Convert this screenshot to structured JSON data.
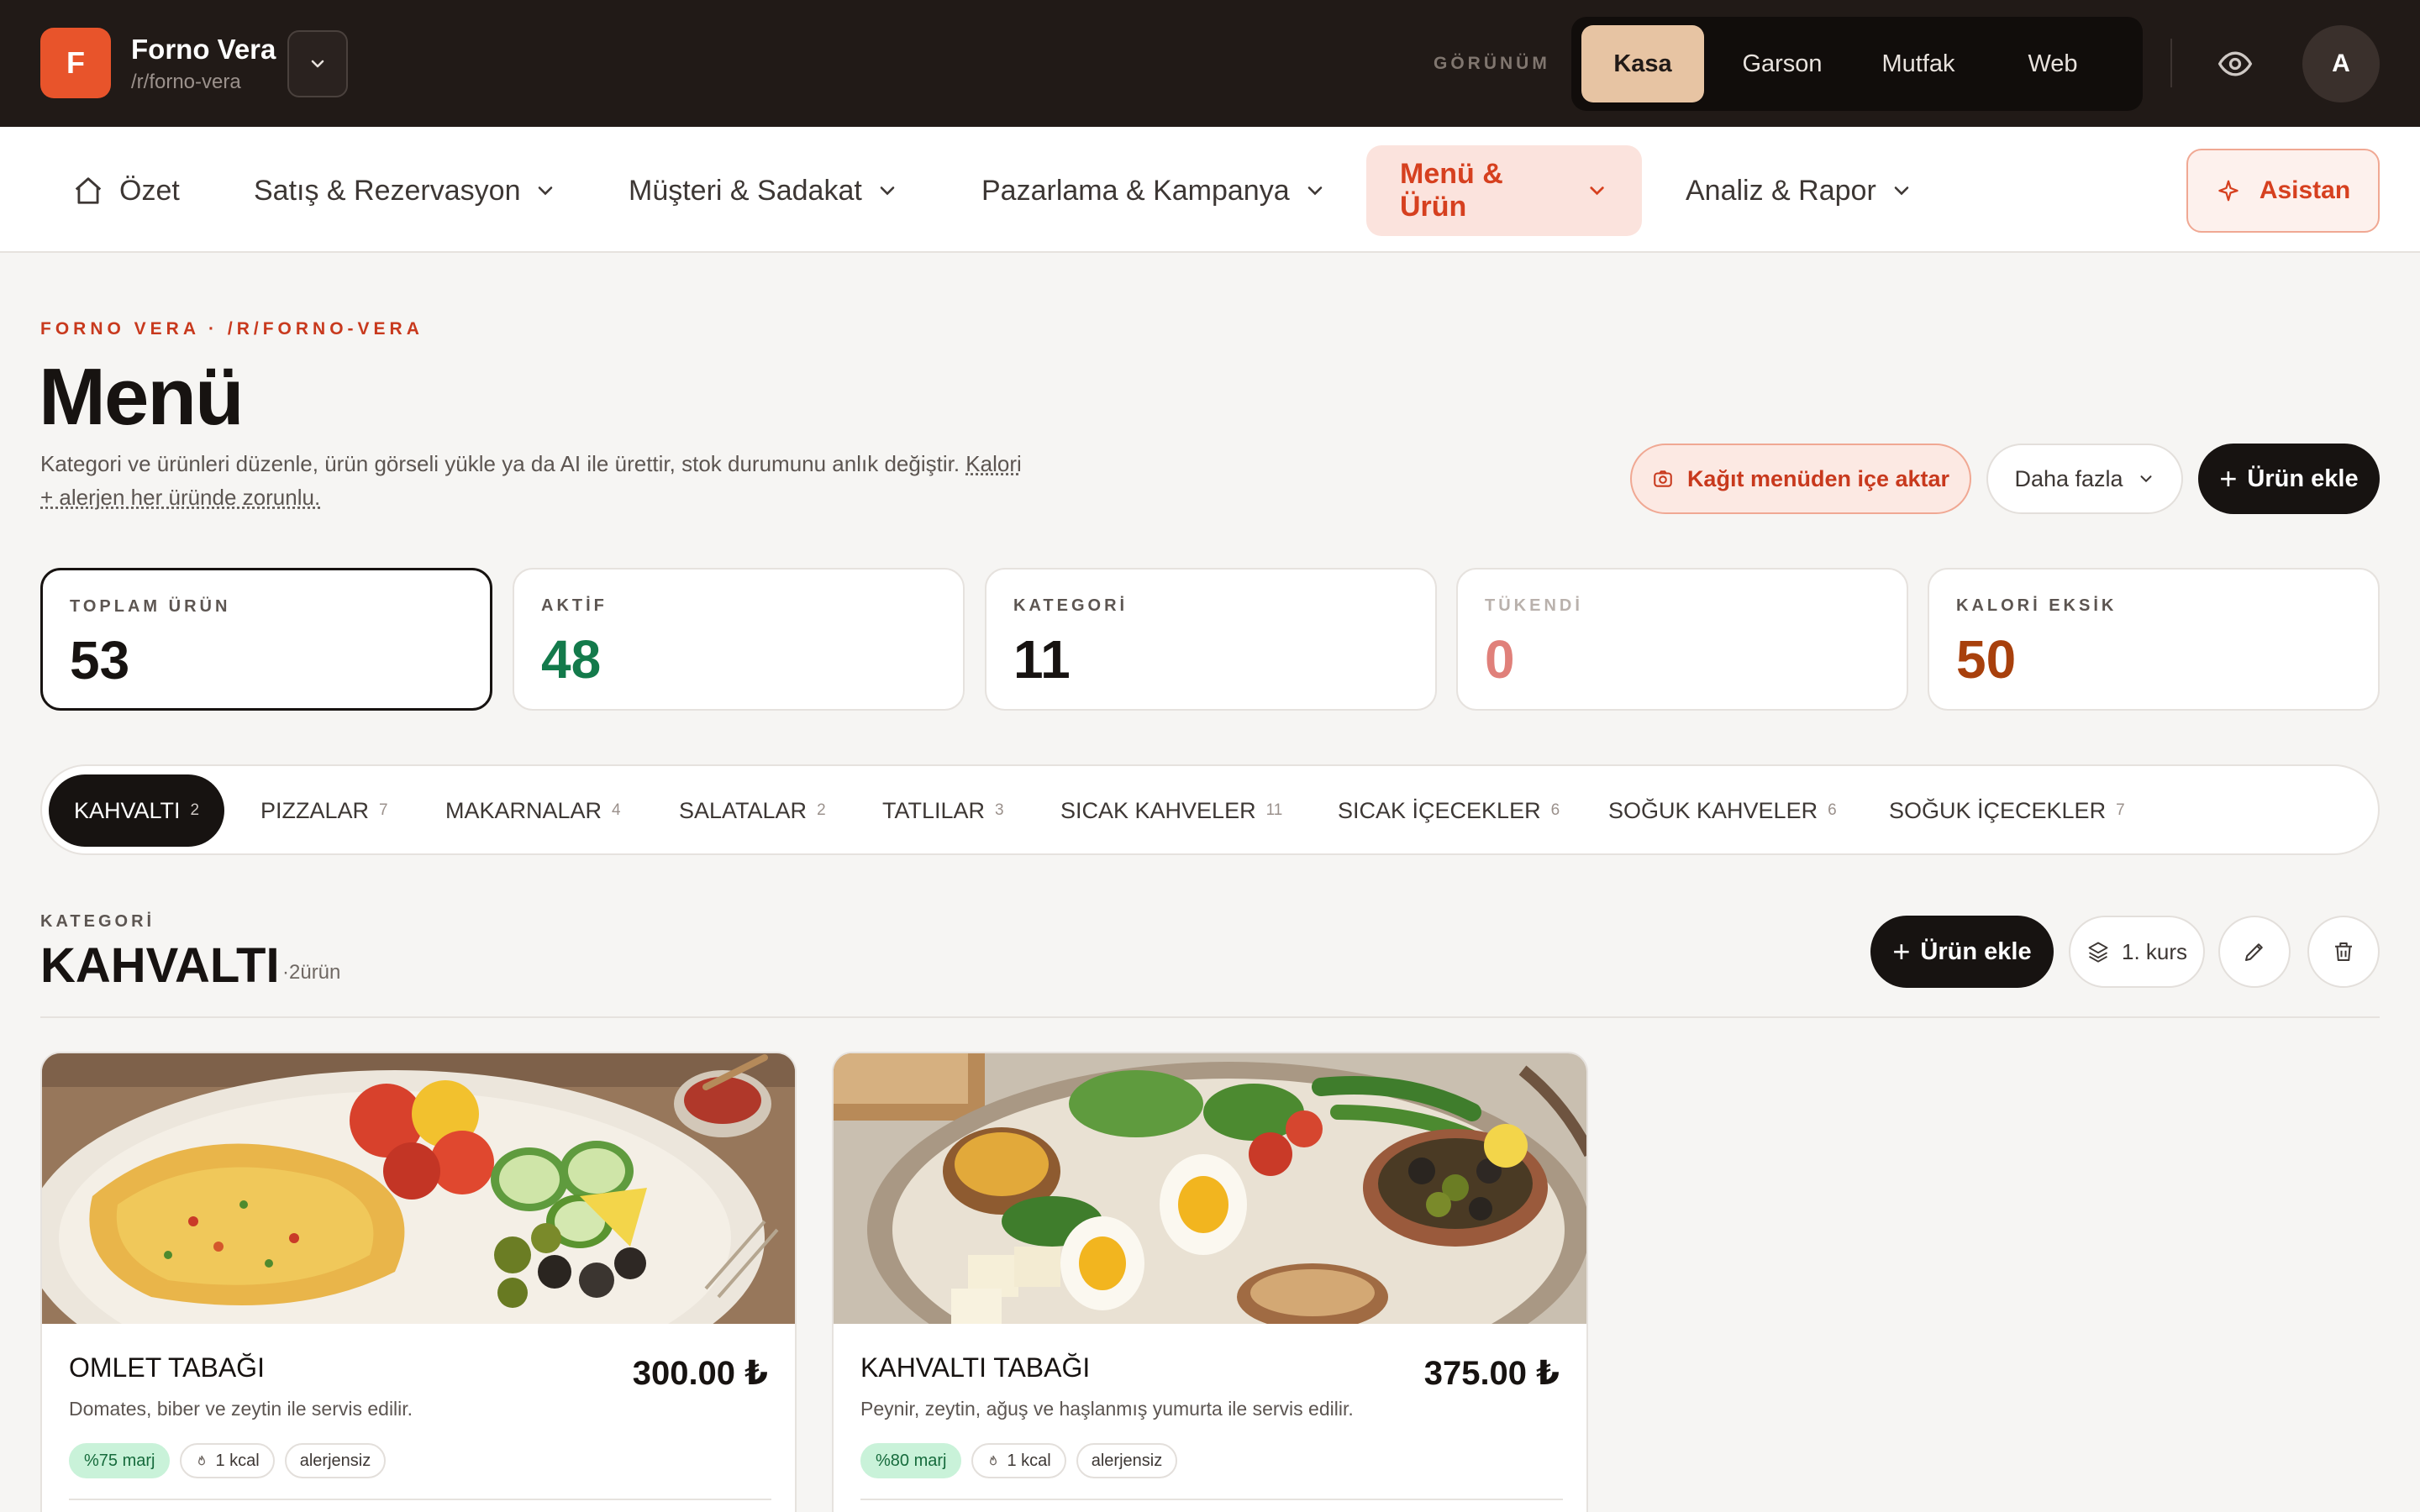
{
  "brand": {
    "initial": "F",
    "name": "Forno Vera",
    "slug": "/r/forno-vera"
  },
  "view_switch": {
    "label": "GÖRÜNÜM",
    "options": [
      "Kasa",
      "Garson",
      "Mutfak",
      "Web"
    ],
    "active": "Kasa"
  },
  "user": {
    "avatar_initial": "A"
  },
  "nav": {
    "items": [
      {
        "label": "Özet"
      },
      {
        "label": "Satış & Rezervasyon"
      },
      {
        "label": "Müşteri & Sadakat"
      },
      {
        "label": "Pazarlama & Kampanya"
      },
      {
        "label": "Menü & Ürün"
      },
      {
        "label": "Analiz & Rapor"
      }
    ],
    "active": "Menü & Ürün",
    "assistant_label": "Asistan"
  },
  "header": {
    "eyebrow": "FORNO VERA · /R/FORNO-VERA",
    "title": "Menü",
    "description_part1": "Kategori ve ürünleri düzenle, ürün görseli yükle ya da AI ile ürettir, stok durumunu anlık değiştir. ",
    "description_link": "Kalori + alerjen her üründe zorunlu.",
    "import_label": "Kağıt menüden içe aktar",
    "more_label": "Daha fazla",
    "add_label": "Ürün ekle"
  },
  "stats": [
    {
      "label": "TOPLAM ÜRÜN",
      "value": "53",
      "color": "#171311"
    },
    {
      "label": "AKTİF",
      "value": "48",
      "color": "#137a4b"
    },
    {
      "label": "KATEGORİ",
      "value": "11",
      "color": "#171311"
    },
    {
      "label": "TÜKENDİ",
      "value": "0",
      "color": "#e0807a"
    },
    {
      "label": "KALORİ EKSİK",
      "value": "50",
      "color": "#a8400c"
    }
  ],
  "categories": [
    {
      "name": "KAHVALTI",
      "count": "2"
    },
    {
      "name": "PIZZALAR",
      "count": "7"
    },
    {
      "name": "MAKARNALAR",
      "count": "4"
    },
    {
      "name": "SALATALAR",
      "count": "2"
    },
    {
      "name": "TATLILAR",
      "count": "3"
    },
    {
      "name": "SICAK KAHVELER",
      "count": "11"
    },
    {
      "name": "SICAK İÇECEKLER",
      "count": "6"
    },
    {
      "name": "SOĞUK KAHVELER",
      "count": "6"
    },
    {
      "name": "SOĞUK İÇECEKLER",
      "count": "7"
    }
  ],
  "active_category": "KAHVALTI",
  "section": {
    "eyebrow": "KATEGORİ",
    "title": "KAHVALTI",
    "count_text": "·2ürün",
    "add_label": "Ürün ekle",
    "course_label": "1. kurs"
  },
  "products": [
    {
      "name": "OMLET TABAĞI",
      "price": "300.00 ₺",
      "description": "Domates, biber ve zeytin ile servis edilir.",
      "margin": "%75 marj",
      "kcal": "1 kcal",
      "allergen": "alerjensiz"
    },
    {
      "name": "KAHVALTI TABAĞI",
      "price": "375.00 ₺",
      "description": "Peynir, zeytin, ağuş ve haşlanmış yumurta ile servis edilir.",
      "margin": "%80 marj",
      "kcal": "1 kcal",
      "allergen": "alerjensiz"
    }
  ]
}
